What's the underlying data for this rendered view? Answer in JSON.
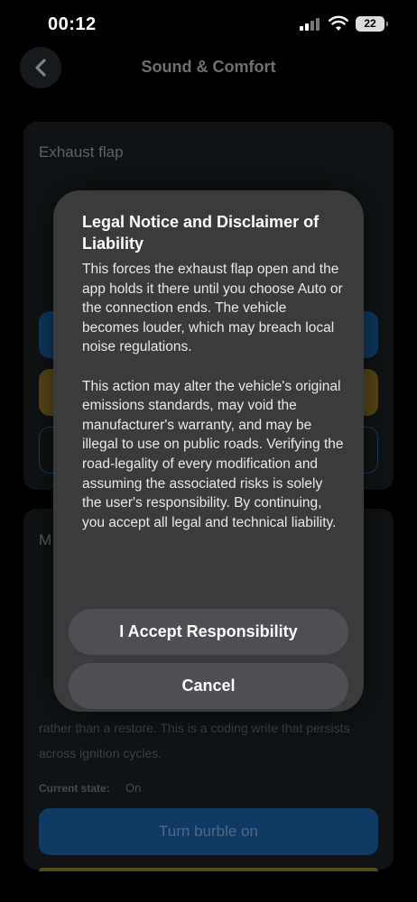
{
  "status": {
    "time": "00:12",
    "battery": "22"
  },
  "header": {
    "title": "Sound & Comfort",
    "back_icon": "chevron-left-icon"
  },
  "exhaust_card": {
    "title": "Exhaust flap"
  },
  "burble_card": {
    "title_visible": "M",
    "text_lines": [
      "rather than a restore. This is a coding write that persists",
      "across ignition cycles."
    ],
    "current_state_label": "Current state:",
    "current_state_value": "On",
    "burble_button": "Turn burble on"
  },
  "modal": {
    "title": "Legal Notice and Disclaimer of Liability",
    "body": "This forces the exhaust flap open and the app holds it there until you choose Auto or the connection ends. The vehicle becomes louder, which may breach local noise regulations.\n\nThis action may alter the vehicle's original emissions standards, may void the manufacturer's warranty, and may be illegal to use on public roads. Verifying the road-legality of every modification and assuming the associated risks is solely the user's responsibility. By continuing, you accept all legal and technical liability.",
    "accept_label": "I Accept Responsibility",
    "cancel_label": "Cancel"
  },
  "colors": {
    "background": "#000000",
    "modal": "#3a3b3d",
    "modal_button": "#4e4f52",
    "primary_blue": "#0f3a63",
    "yellow": "#5b4a16"
  }
}
